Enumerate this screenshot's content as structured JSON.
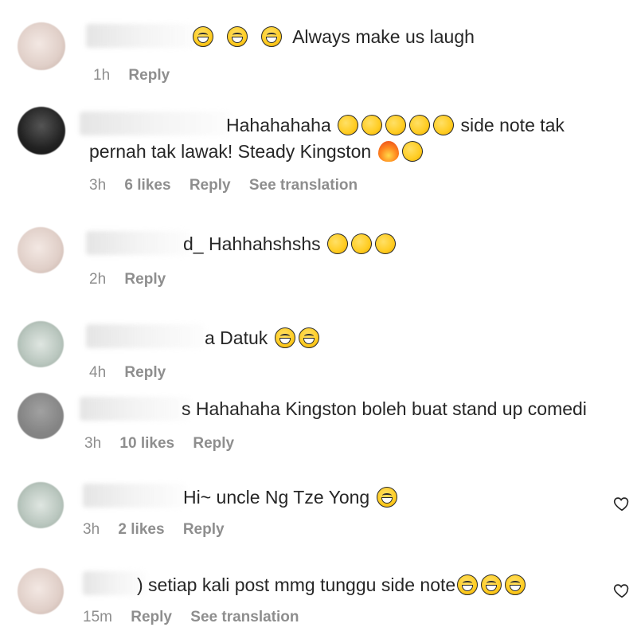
{
  "comments": [
    {
      "text": "Always make us laugh",
      "emojis_before": [
        "laugh",
        "laugh",
        "laugh"
      ],
      "time": "1h",
      "reply_label": "Reply"
    },
    {
      "text_line1": "Hahahahaha",
      "text_line1_after": "side note tak",
      "text_line2": "pernah tak lawak! Steady Kingston",
      "time": "3h",
      "likes": "6 likes",
      "reply_label": "Reply",
      "translate_label": "See translation"
    },
    {
      "text": "d_ Hahhahshshs",
      "time": "2h",
      "reply_label": "Reply"
    },
    {
      "text": "a Datuk",
      "time": "4h",
      "reply_label": "Reply"
    },
    {
      "text": "s Hahahaha Kingston boleh buat stand up comedi",
      "time": "3h",
      "likes": "10 likes",
      "reply_label": "Reply"
    },
    {
      "text": "Hi~ uncle Ng Tze Yong",
      "time": "3h",
      "likes": "2 likes",
      "reply_label": "Reply"
    },
    {
      "text": ") setiap kali post mmg tunggu side note",
      "time": "15m",
      "reply_label": "Reply",
      "translate_label": "See translation"
    }
  ],
  "icons": {
    "heart": "heart-outline-icon",
    "laugh": "face-with-tears-of-joy-icon",
    "rofl": "rolling-on-floor-laughing-icon",
    "fire": "fire-icon"
  }
}
